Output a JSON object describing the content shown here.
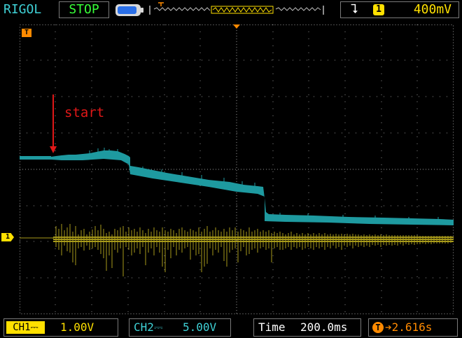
{
  "header": {
    "brand": "RIGOL",
    "run_state": "STOP",
    "trigger": {
      "slope_icon": "falling-edge-icon",
      "source": "1",
      "level": "400mV"
    }
  },
  "screen": {
    "trigger_marker": "T",
    "channel1_marker": "1",
    "annotation": "start"
  },
  "footer": {
    "ch1": {
      "label": "CH1",
      "coupling_icon": "dc-coupling-icon",
      "scale": "1.00V"
    },
    "ch2": {
      "label": "CH2",
      "coupling_icon": "dc-coupling-icon",
      "scale": "5.00V"
    },
    "time": {
      "label": "Time",
      "value": "200.0ms"
    },
    "trigger_offset": {
      "icon": "trigger-offset-icon",
      "value": "2.616s"
    }
  },
  "colors": {
    "ch1_trace": "#a89a1a",
    "ch2_trace": "#1e9aa0",
    "grid": "#8a8a8a",
    "annotation": "#e01818"
  }
}
